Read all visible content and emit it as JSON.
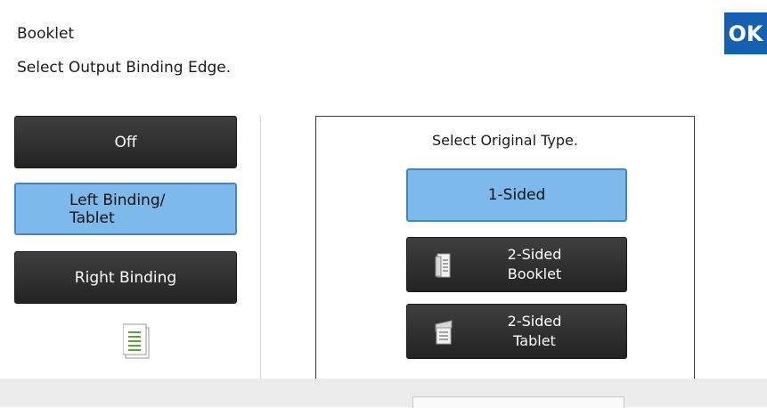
{
  "header": {
    "title": "Booklet",
    "subtitle": "Select Output Binding Edge.",
    "ok_label": "OK"
  },
  "binding_options": [
    {
      "label": "Off",
      "selected": false
    },
    {
      "label": "Left Binding/ Tablet",
      "selected": true
    },
    {
      "label": "Right Binding",
      "selected": false
    }
  ],
  "original_type": {
    "prompt": "Select Original Type.",
    "options": [
      {
        "label": "1-Sided",
        "selected": true,
        "icon": ""
      },
      {
        "label_line1": "2-Sided",
        "label_line2": "Booklet",
        "selected": false,
        "icon": "booklet-icon"
      },
      {
        "label_line1": "2-Sided",
        "label_line2": "Tablet",
        "selected": false,
        "icon": "tablet-icon"
      }
    ]
  },
  "colors": {
    "accent": "#1560b0",
    "selected": "#7db9ea",
    "button_dark": "#2e2e2e"
  }
}
